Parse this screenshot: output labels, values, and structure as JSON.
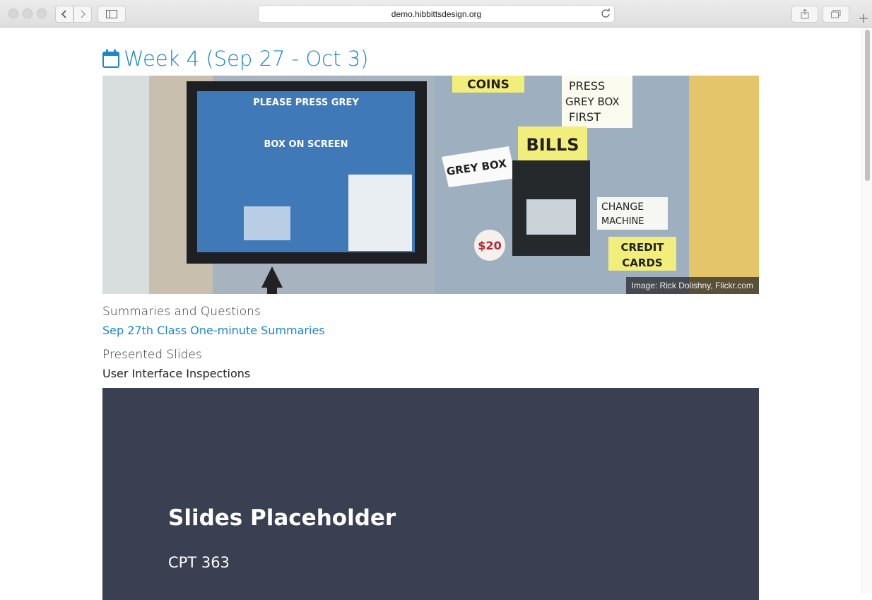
{
  "browser": {
    "url": "demo.hibbittsdesign.org"
  },
  "page": {
    "week_title": "Week 4 (Sep 27 - Oct 3)",
    "image_credit": "Image: Rick Dolishny, Flickr.com",
    "image_sign_texts": [
      "PLEASE PRESS GREY",
      "BOX ON SCREEN",
      "COINS",
      "PRESS",
      "GREY BOX",
      "FIRST",
      "BILLS",
      "GREY BOX",
      "CHANGE",
      "MACHINE",
      "CREDIT",
      "CARDS",
      "$20"
    ],
    "summaries_label": "Summaries and Questions",
    "summaries_link": "Sep 27th Class One-minute Summaries",
    "slides_label": "Presented Slides",
    "slides_name": "User Interface Inspections",
    "slide_title": "Slides Placeholder",
    "slide_subtitle": "CPT 363"
  },
  "colors": {
    "link": "#1a86cc",
    "slide_bg": "#3a3f52"
  }
}
